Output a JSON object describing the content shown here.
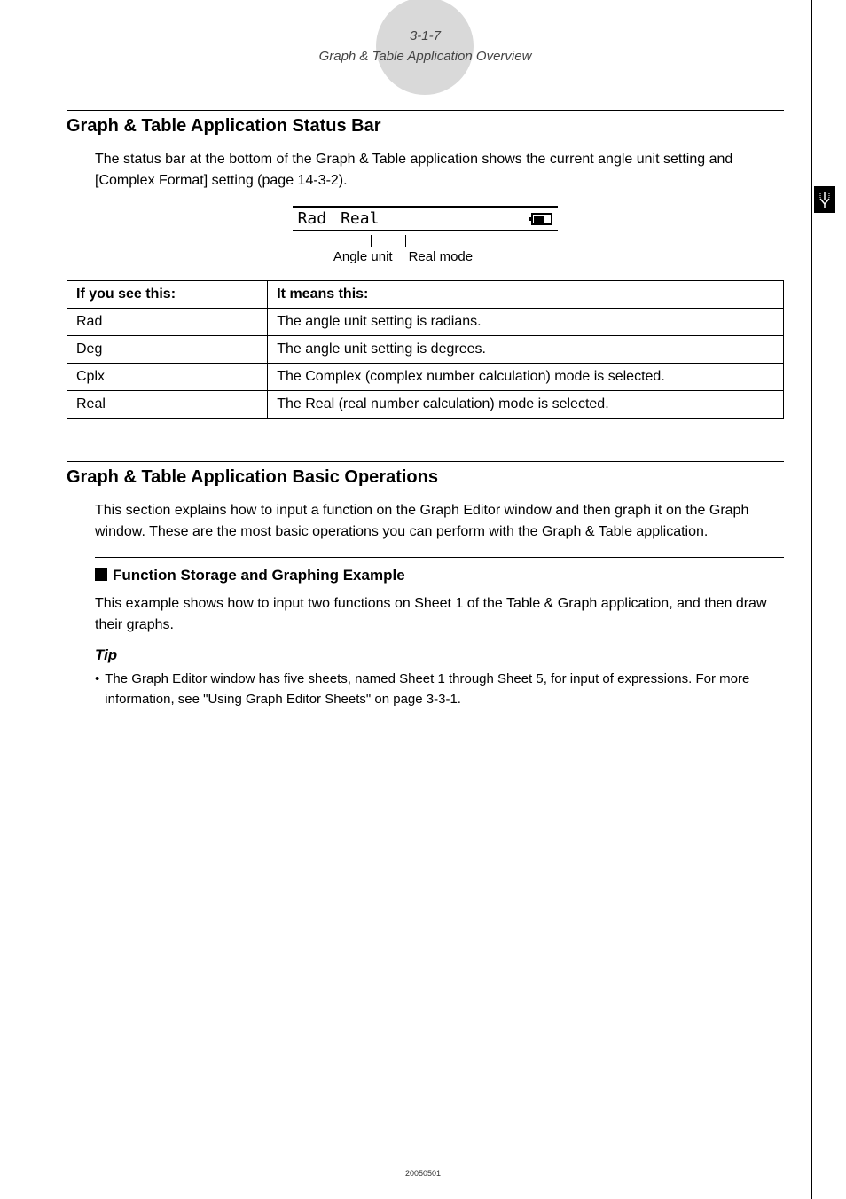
{
  "header": {
    "pageNum": "3-1-7",
    "title": "Graph & Table Application Overview"
  },
  "section1": {
    "heading": "Graph & Table Application Status Bar",
    "intro": "The status bar at the bottom of the Graph & Table application shows the current angle unit setting and [Complex Format] setting (page 14-3-2).",
    "statusbar": {
      "angle": "Rad",
      "mode": "Real"
    },
    "callouts": {
      "angle": "Angle unit",
      "mode": "Real mode"
    },
    "table": {
      "headers": {
        "col1": "If you see this:",
        "col2": "It means this:"
      },
      "rows": [
        {
          "c1": "Rad",
          "c2": "The angle unit setting is radians."
        },
        {
          "c1": "Deg",
          "c2": "The angle unit setting is degrees."
        },
        {
          "c1": "Cplx",
          "c2": "The Complex (complex number calculation) mode is selected."
        },
        {
          "c1": "Real",
          "c2": "The Real (real number calculation) mode is selected."
        }
      ]
    }
  },
  "section2": {
    "heading": "Graph & Table Application Basic Operations",
    "intro": "This section explains how to input a function on the Graph Editor window and then graph it on the Graph window. These are the most basic operations you can perform with the Graph & Table application.",
    "subHeading": "Function Storage and Graphing Example",
    "subIntro": "This example shows how to input two functions on Sheet 1 of the Table & Graph application, and then draw their graphs.",
    "tipLabel": "Tip",
    "tipBody": "The Graph Editor window has five sheets, named Sheet 1 through Sheet 5, for input of expressions. For more information, see \"Using Graph Editor Sheets\" on page 3-3-1."
  },
  "footer": {
    "code": "20050501"
  }
}
